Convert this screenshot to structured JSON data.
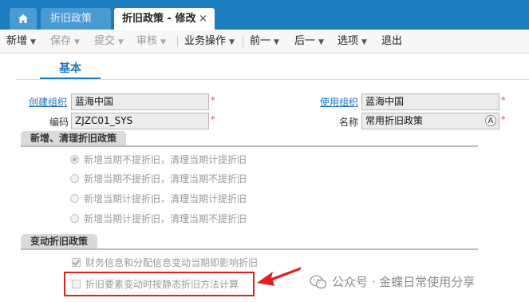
{
  "tabs": {
    "home_icon": "home-icon",
    "policy": "折旧政策",
    "active": "折旧政策 - 修改",
    "close": "×"
  },
  "toolbar": {
    "add": "新增",
    "save": "保存",
    "submit": "提交",
    "audit": "审核",
    "business": "业务操作",
    "prev": "前一",
    "next": "后一",
    "options": "选项",
    "exit": "退出"
  },
  "section_tab": "基本",
  "form": {
    "create_org_label": "创建组织",
    "create_org_value": "蓝海中国",
    "use_org_label": "使用组织",
    "use_org_value": "蓝海中国",
    "code_label": "编码",
    "code_value": "ZJZC01_SYS",
    "name_label": "名称",
    "name_value": "常用折旧政策",
    "required_mark": "*",
    "lang_icon_letter": "A"
  },
  "group1": {
    "title": "新增、清理折旧政策",
    "options": [
      {
        "label": "新增当期不提折旧，清理当期计提折旧",
        "selected": true
      },
      {
        "label": "新增当期不提折旧，清理当期不提折旧",
        "selected": false
      },
      {
        "label": "新增当期计提折旧，清理当期计提折旧",
        "selected": false
      },
      {
        "label": "新增当期计提折旧，清理当期不提折旧",
        "selected": false
      }
    ]
  },
  "group2": {
    "title": "变动折旧政策",
    "check1": {
      "label": "财务信息和分配信息变动当期即影响折旧",
      "checked": true
    },
    "check2": {
      "label": "折旧要素变动时按静态折旧方法计算",
      "checked": false
    }
  },
  "watermark": "公众号 · 金蝶日常使用分享",
  "colors": {
    "brand": "#1b7bbf",
    "highlight": "#e02020"
  }
}
